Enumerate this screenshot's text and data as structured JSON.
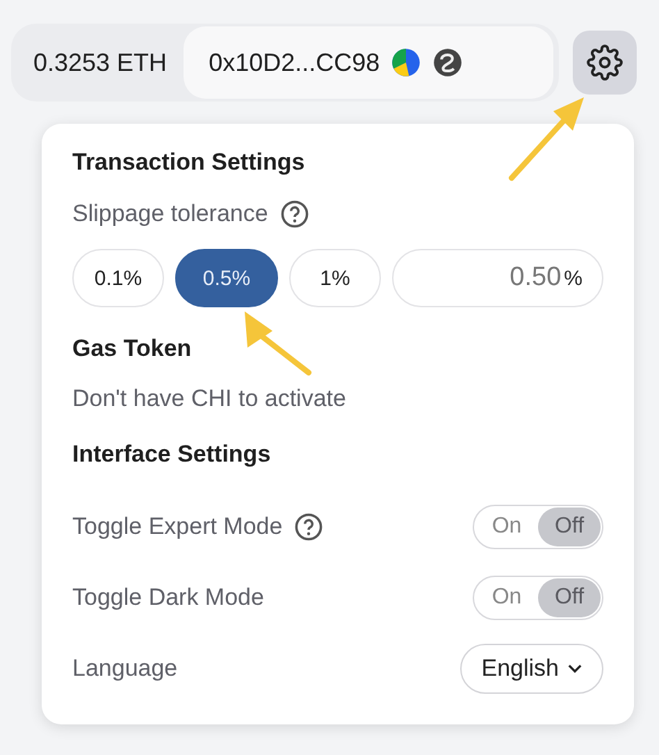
{
  "header": {
    "balance": "0.3253 ETH",
    "address": "0x10D2...CC98"
  },
  "settings": {
    "title": "Transaction Settings",
    "slippage_label": "Slippage tolerance",
    "slippage_options": [
      {
        "label": "0.1%",
        "selected": false
      },
      {
        "label": "0.5%",
        "selected": true
      },
      {
        "label": "1%",
        "selected": false
      }
    ],
    "custom_slippage": {
      "value": "0.50",
      "unit": "%"
    },
    "gas_title": "Gas Token",
    "gas_note": "Don't have CHI to activate",
    "interface_title": "Interface Settings",
    "toggles": [
      {
        "label": "Toggle Expert Mode",
        "help": true,
        "on_label": "On",
        "off_label": "Off",
        "on": false
      },
      {
        "label": "Toggle Dark Mode",
        "help": false,
        "on_label": "On",
        "off_label": "Off",
        "on": false
      }
    ],
    "language": {
      "label": "Language",
      "value": "English"
    }
  }
}
